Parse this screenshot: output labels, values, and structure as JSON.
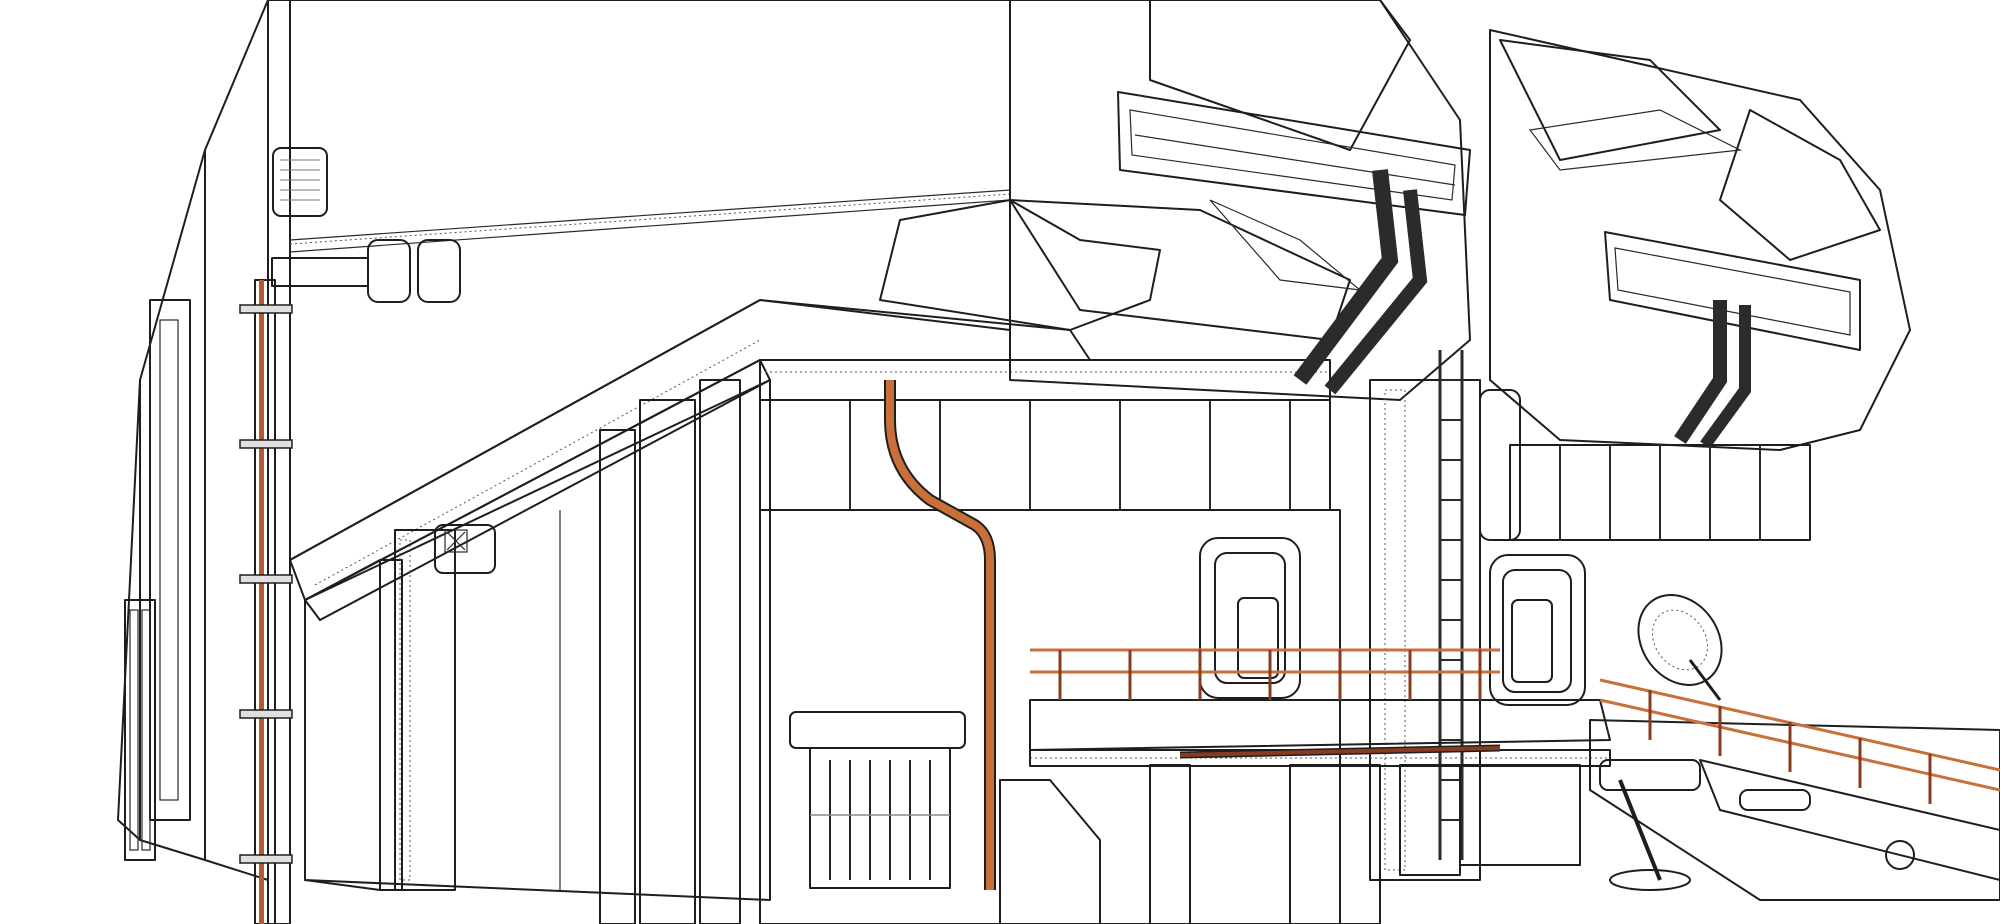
{
  "scene": {
    "subject": "",
    "colors": {
      "background": "#ffffff",
      "wall_light": "#e7e7e7",
      "wall_mid": "#cfcfcf",
      "wall_dark": "#5a5a5a",
      "panel_darker": "#3f3f3f",
      "accent_orange": "#e8b98c",
      "accent_peach": "#f3c9a0",
      "pipe_rust": "#8a3b1f",
      "pipe_orange": "#d07a3c",
      "window_blue": "#9db2d6",
      "outline": "#1e1e1e"
    },
    "icons": [
      "vent-grille-icon",
      "satellite-dish-icon",
      "door-icon",
      "ladder-icon",
      "railing-icon",
      "pipe-icon"
    ]
  }
}
